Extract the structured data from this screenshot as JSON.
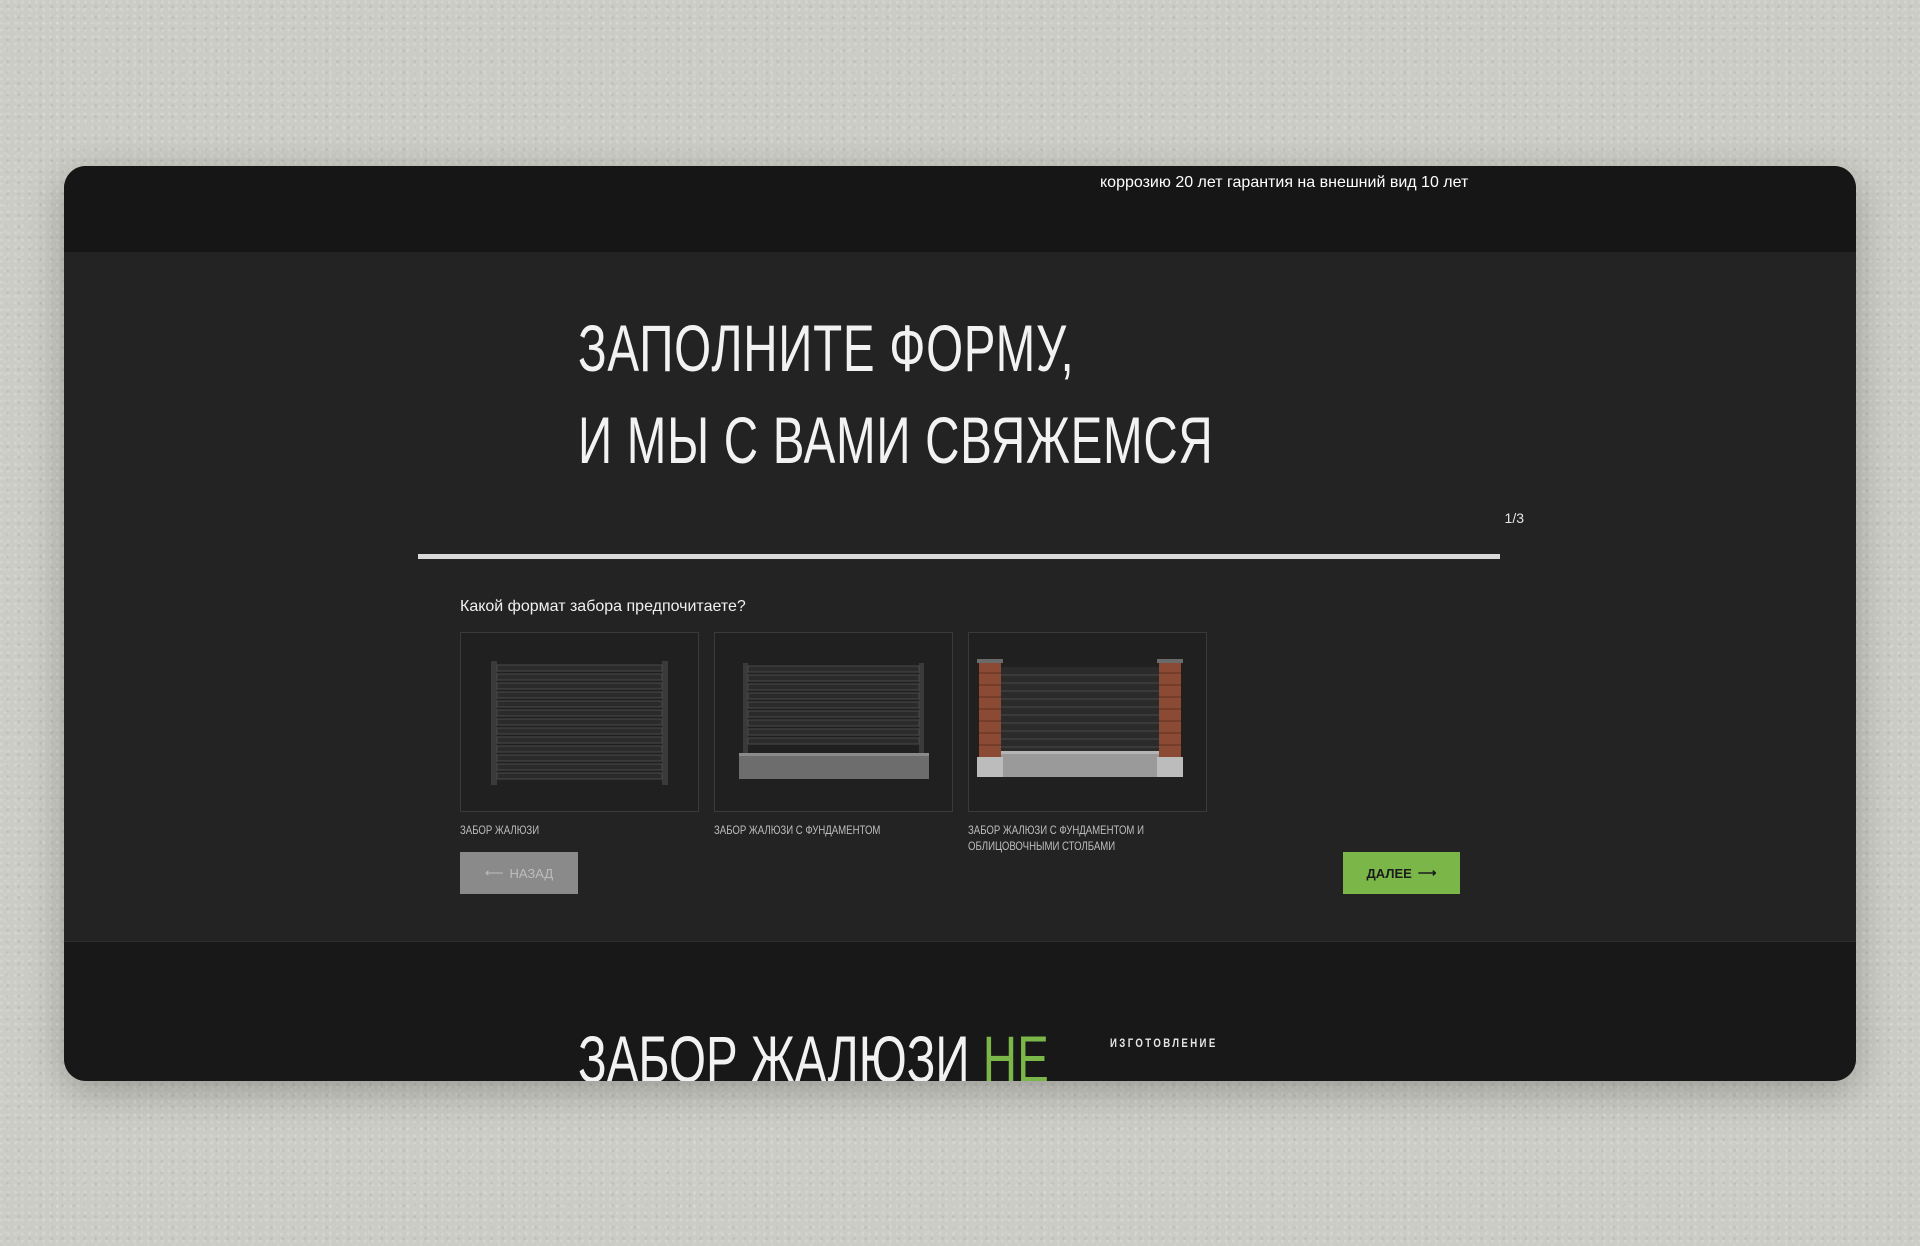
{
  "header": {
    "warranty_text": "коррозию 20 лет гарантия на внешний вид 10 лет"
  },
  "form": {
    "title_line1": "ЗАПОЛНИТЕ ФОРМУ,",
    "title_line2": "И МЫ С ВАМИ СВЯЖЕМСЯ",
    "step_counter": "1/3",
    "progress_fraction": 0.333,
    "question": "Какой формат забора предпочитаете?",
    "options": [
      {
        "label": "ЗАБОР ЖАЛЮЗИ"
      },
      {
        "label": "ЗАБОР ЖАЛЮЗИ С ФУНДАМЕНТОМ"
      },
      {
        "label": "ЗАБОР ЖАЛЮЗИ С ФУНДАМЕНТОМ И ОБЛИЦОВОЧНЫМИ СТОЛБАМИ"
      }
    ],
    "back_label": "НАЗАД",
    "next_label": "ДАЛЕЕ",
    "back_arrow": "⟵",
    "next_arrow": "⟶"
  },
  "bottom": {
    "title_main": "ЗАБОР ЖАЛЮЗИ ",
    "title_accent": "НЕ",
    "tag": "ИЗГОТОВЛЕНИЕ"
  },
  "colors": {
    "accent": "#7ab648",
    "panel": "#232323",
    "dark": "#181818"
  }
}
